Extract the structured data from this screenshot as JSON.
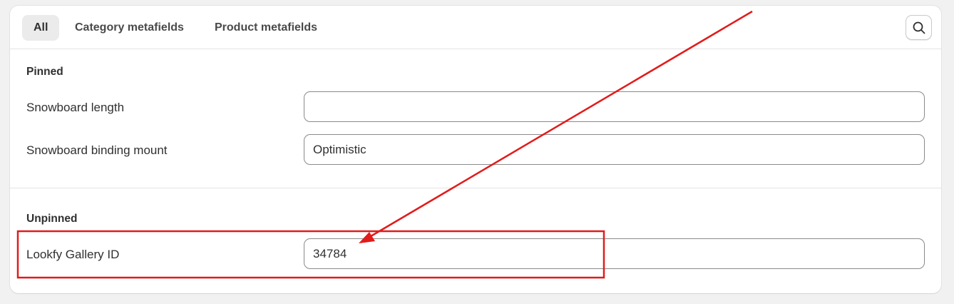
{
  "tabs": [
    {
      "label": "All",
      "active": true
    },
    {
      "label": "Category metafields",
      "active": false
    },
    {
      "label": "Product metafields",
      "active": false
    }
  ],
  "search_icon": "search-icon",
  "pinned": {
    "title": "Pinned",
    "rows": [
      {
        "label": "Snowboard length",
        "value": ""
      },
      {
        "label": "Snowboard binding mount",
        "value": "Optimistic"
      }
    ]
  },
  "unpinned": {
    "title": "Unpinned",
    "rows": [
      {
        "label": "Lookfy Gallery ID",
        "value": "34784"
      }
    ]
  },
  "annotation": {
    "color": "#e21b1b",
    "shapes": [
      "arrow",
      "highlight-box"
    ]
  }
}
